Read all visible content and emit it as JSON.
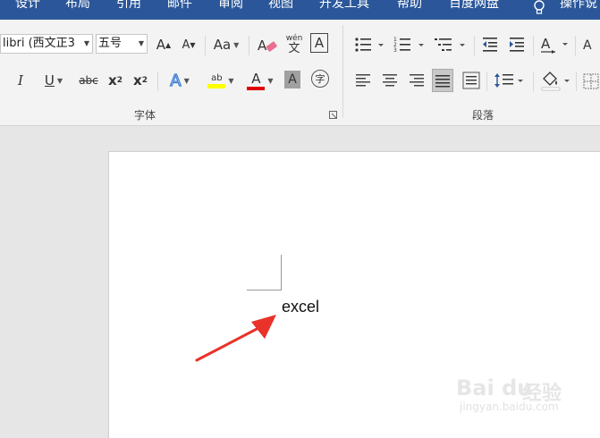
{
  "tabs": [
    "设计",
    "布局",
    "引用",
    "邮件",
    "审阅",
    "视图",
    "开发工具",
    "帮助",
    "百度网盘",
    "操作说"
  ],
  "font_group": {
    "label": "字体",
    "font_name": "libri (西文正3",
    "font_size": "五号",
    "grow_font": "A",
    "shrink_font": "A",
    "change_case": "Aa",
    "phonetic_top": "wén",
    "phonetic_char": "文",
    "char_border": "A",
    "italic": "I",
    "underline": "U",
    "strikethrough": "abc",
    "subscript": "x",
    "subscript_mark": "2",
    "superscript": "x",
    "superscript_mark": "2",
    "text_effect": "A",
    "highlight": "ab",
    "font_color": "A",
    "char_shading": "A",
    "enclose_char": "字"
  },
  "paragraph_group": {
    "label": "段落"
  },
  "colors": {
    "accent": "#2b579a",
    "highlight": "#ffff00",
    "font_color": "#e00000",
    "arrow": "#e8322a"
  },
  "document": {
    "text": "excel"
  },
  "watermark": {
    "logo": "Bai du",
    "cn": "经验",
    "url": "jingyan.baidu.com"
  }
}
